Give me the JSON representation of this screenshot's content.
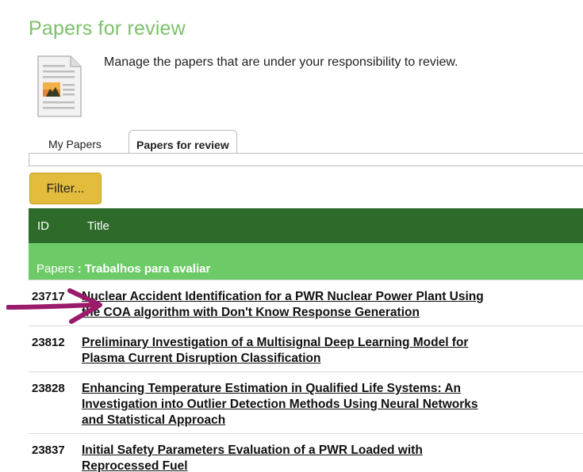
{
  "page": {
    "title": "Papers for review",
    "description": "Manage the papers that are under your responsibility to review."
  },
  "tabs": [
    {
      "label": "My Papers",
      "active": false
    },
    {
      "label": "Papers for review",
      "active": true
    }
  ],
  "filter": {
    "label": "Filter..."
  },
  "table": {
    "headers": {
      "id": "ID",
      "title": "Title"
    },
    "group": {
      "prefix": "Papers",
      "separator": " : ",
      "name": "Trabalhos para avaliar"
    },
    "rows": [
      {
        "id": "23717",
        "title_lines": [
          "Nuclear Accident Identification for a PWR Nuclear Power Plant Using",
          "the COA algorithm with Don't Know Response Generation"
        ]
      },
      {
        "id": "23812",
        "title_lines": [
          "Preliminary Investigation of a Multisignal Deep Learning Model for",
          "Plasma Current Disruption Classification"
        ]
      },
      {
        "id": "23828",
        "title_lines": [
          "Enhancing Temperature Estimation in Qualified Life Systems: An",
          "Investigation into Outlier Detection Methods Using Neural Networks",
          "and Statistical Approach"
        ]
      },
      {
        "id": "23837",
        "title_lines": [
          "Initial Safety Parameters Evaluation of a PWR Loaded with",
          "Reprocessed Fuel"
        ]
      }
    ]
  },
  "colors": {
    "title": "#7cc26a",
    "header_bg": "#2e6b2a",
    "group_bg": "#6ccb66",
    "filter_bg": "#e3bc3d",
    "annotation_arrow": "#9b1b6b"
  },
  "icons": {
    "page_icon": "document-with-image-icon",
    "annotation": "pointer-arrow-icon"
  }
}
